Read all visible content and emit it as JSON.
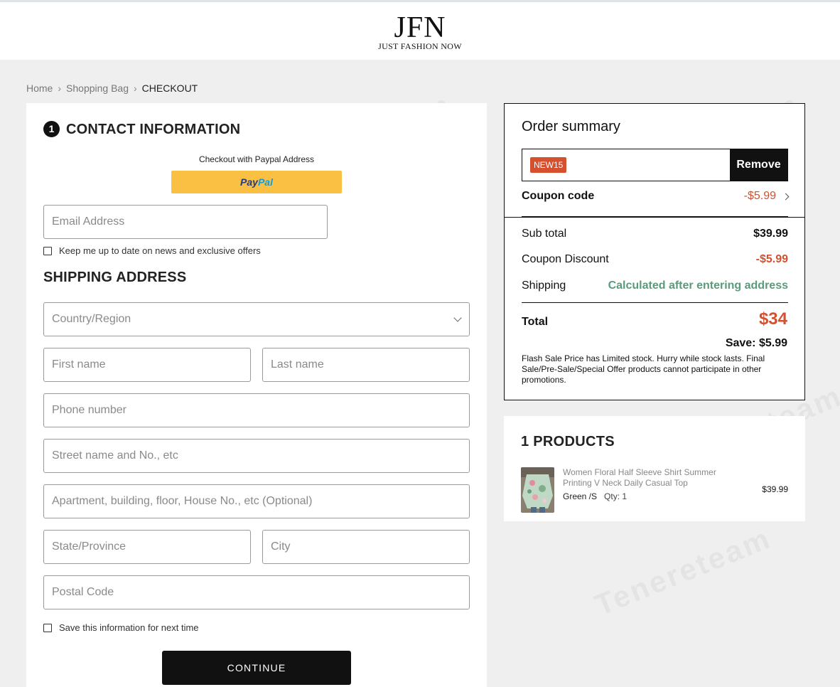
{
  "header": {
    "logo_main": "JFN",
    "logo_sub": "JUST FASHION NOW"
  },
  "breadcrumb": {
    "items": [
      "Home",
      "Shopping Bag",
      "CHECKOUT"
    ]
  },
  "contact": {
    "step": "1",
    "title": "CONTACT INFORMATION",
    "paypal_note": "Checkout with Paypal Address",
    "paypal_pay": "Pay",
    "paypal_pal": "Pal",
    "email_placeholder": "Email Address",
    "newsletter_label": "Keep me up to date on news and exclusive offers"
  },
  "shipping": {
    "title": "SHIPPING ADDRESS",
    "country_placeholder": "Country/Region",
    "first_name_placeholder": "First name",
    "last_name_placeholder": "Last name",
    "phone_placeholder": "Phone number",
    "street_placeholder": "Street name and No., etc",
    "apartment_placeholder": "Apartment, building, floor, House No., etc (Optional)",
    "state_placeholder": "State/Province",
    "city_placeholder": "City",
    "postal_placeholder": "Postal Code",
    "save_info_label": "Save this information for next time",
    "continue_label": "CONTINUE"
  },
  "summary": {
    "title": "Order summary",
    "coupon_tag": "NEW15",
    "remove_label": "Remove",
    "coupon_label": "Coupon code",
    "coupon_value": "-$5.99",
    "subtotal_label": "Sub total",
    "subtotal_value": "$39.99",
    "discount_label": "Coupon Discount",
    "discount_value": "-$5.99",
    "shipping_label": "Shipping",
    "shipping_value": "Calculated after entering address",
    "total_label": "Total",
    "total_value": "$34",
    "save_text": "Save: $5.99",
    "note": "Flash Sale Price has Limited stock. Hurry while stock lasts. Final Sale/Pre-Sale/Special Offer products cannot participate in other promotions."
  },
  "products": {
    "title": "1 PRODUCTS",
    "items": [
      {
        "name": "Women Floral Half Sleeve Shirt Summer Printing V Neck Daily Casual Top",
        "variant": "Green /S",
        "qty": "Qty: 1",
        "price": "$39.99"
      }
    ]
  },
  "colors": {
    "accent_red": "#d4502e",
    "shipping_green": "#5a9b7a",
    "paypal_yellow": "#f9c043"
  }
}
